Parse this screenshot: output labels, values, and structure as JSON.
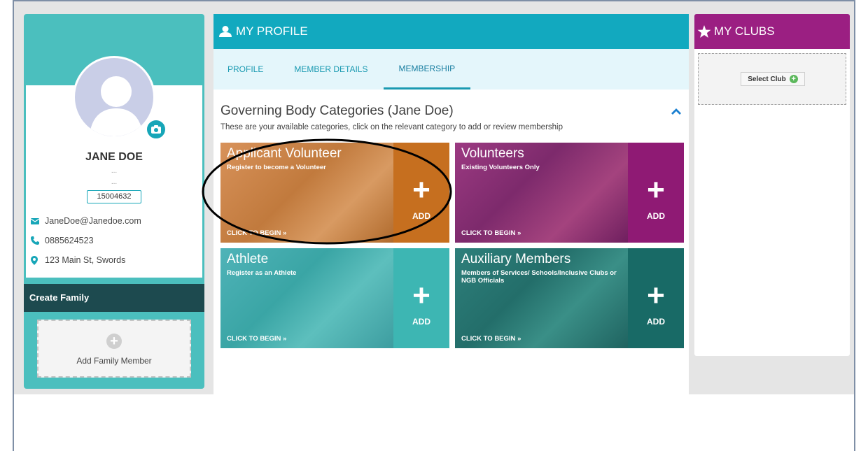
{
  "profile": {
    "name": "JANE DOE",
    "dots1": "...",
    "dots2": "...",
    "member_id": "15004632",
    "email": "JaneDoe@Janedoe.com",
    "phone": "0885624523",
    "address": "123 Main St, Swords"
  },
  "family": {
    "create_label": "Create Family",
    "add_label": "Add Family Member",
    "add_icon": "+"
  },
  "main": {
    "header_title": "MY PROFILE",
    "tabs": [
      {
        "label": "PROFILE"
      },
      {
        "label": "MEMBER DETAILS"
      },
      {
        "label": "MEMBERSHIP",
        "active": true
      }
    ],
    "section_title": "Governing Body Categories (Jane Doe)",
    "section_subtitle": "These are your available categories, click on the relevant category to add or review membership",
    "categories": [
      {
        "title": "Applicant Volunteer",
        "subtitle": "Register to become a Volunteer",
        "cta": "CLICK TO BEGIN",
        "action": "ADD",
        "color": "#c66f1f"
      },
      {
        "title": "Volunteers",
        "subtitle": "Existing Volunteers Only",
        "cta": "CLICK TO BEGIN",
        "action": "ADD",
        "color": "#8f1a74"
      },
      {
        "title": "Athlete",
        "subtitle": "Register as an Athlete",
        "cta": "CLICK TO BEGIN",
        "action": "ADD",
        "color": "#3db6b3"
      },
      {
        "title": "Auxiliary Members",
        "subtitle": "Members of Services/ Schools/Inclusive Clubs or NGB Officials",
        "cta": "CLICK TO BEGIN",
        "action": "ADD",
        "color": "#186a66"
      }
    ],
    "plus_symbol": "+",
    "chevron_symbol": "»"
  },
  "clubs": {
    "header_title": "MY CLUBS",
    "select_label": "Select Club",
    "select_icon": "+"
  },
  "colors": {
    "teal": "#12a9bf",
    "purple": "#9b1f82",
    "dark_teal": "#1d4a4f"
  },
  "icons": [
    "user-icon",
    "camera-icon",
    "envelope-icon",
    "phone-icon",
    "map-marker-icon",
    "chevron-up-icon",
    "star-icon",
    "plus-circle-icon"
  ]
}
